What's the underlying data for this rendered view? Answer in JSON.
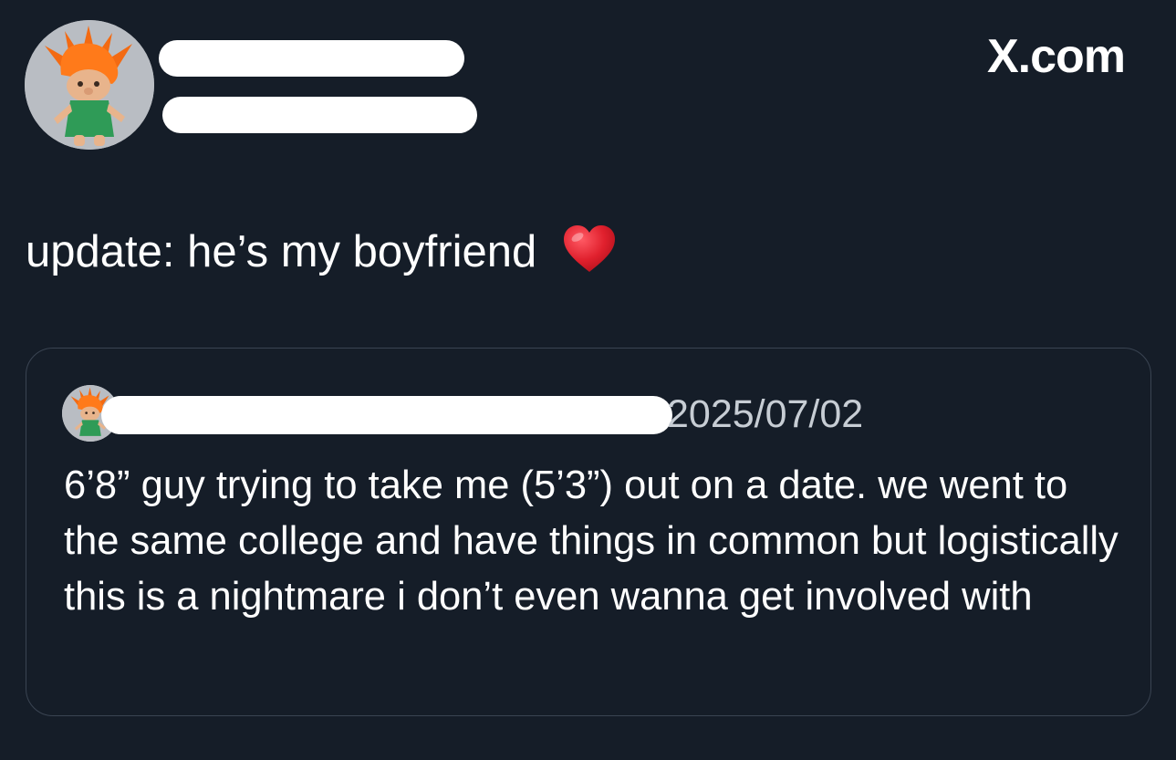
{
  "post": {
    "brand": "X.com",
    "text": "update: he’s my boyfriend",
    "emoji_name": "red-heart"
  },
  "quoted": {
    "date": "2025/07/02",
    "text": "6’8” guy trying to take me (5’3”) out on a date. we went to the same college and have things in common but logistically this is a nightmare i don’t even wanna get involved with"
  },
  "colors": {
    "background": "#151d28",
    "text": "#ffffff",
    "muted_text": "#c7cdd4",
    "card_border": "#3a4452",
    "redaction": "#ffffff",
    "heart": "#e0202d"
  },
  "icons": [
    "troll-doll-avatar",
    "red-heart-emoji",
    "x-logo"
  ]
}
